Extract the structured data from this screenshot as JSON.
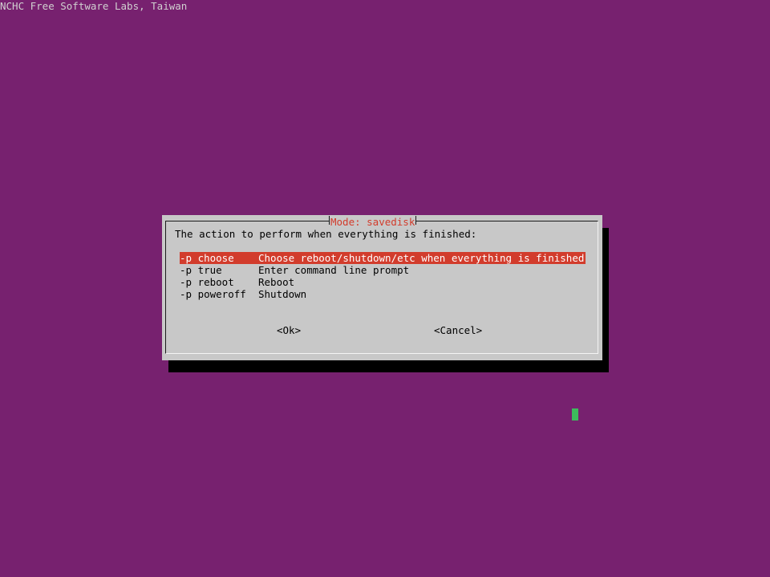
{
  "backtitle": "NCHC Free Software Labs, Taiwan",
  "dialog": {
    "title": "Mode: savedisk",
    "prompt": "The action to perform when everything is finished:",
    "menu": [
      {
        "tag": "-p choose",
        "description": "Choose reboot/shutdown/etc when everything is finished",
        "selected": true
      },
      {
        "tag": "-p true",
        "description": "Enter command line prompt",
        "selected": false
      },
      {
        "tag": "-p reboot",
        "description": "Reboot",
        "selected": false
      },
      {
        "tag": "-p poweroff",
        "description": "Shutdown",
        "selected": false
      }
    ],
    "buttons": {
      "ok": "<Ok>",
      "cancel": "<Cancel>"
    }
  },
  "colors": {
    "background": "#77216f",
    "dialog": "#c8c8c8",
    "highlight": "#d23c2c",
    "title": "#d23c2c",
    "cursor": "#3dbb5c"
  }
}
